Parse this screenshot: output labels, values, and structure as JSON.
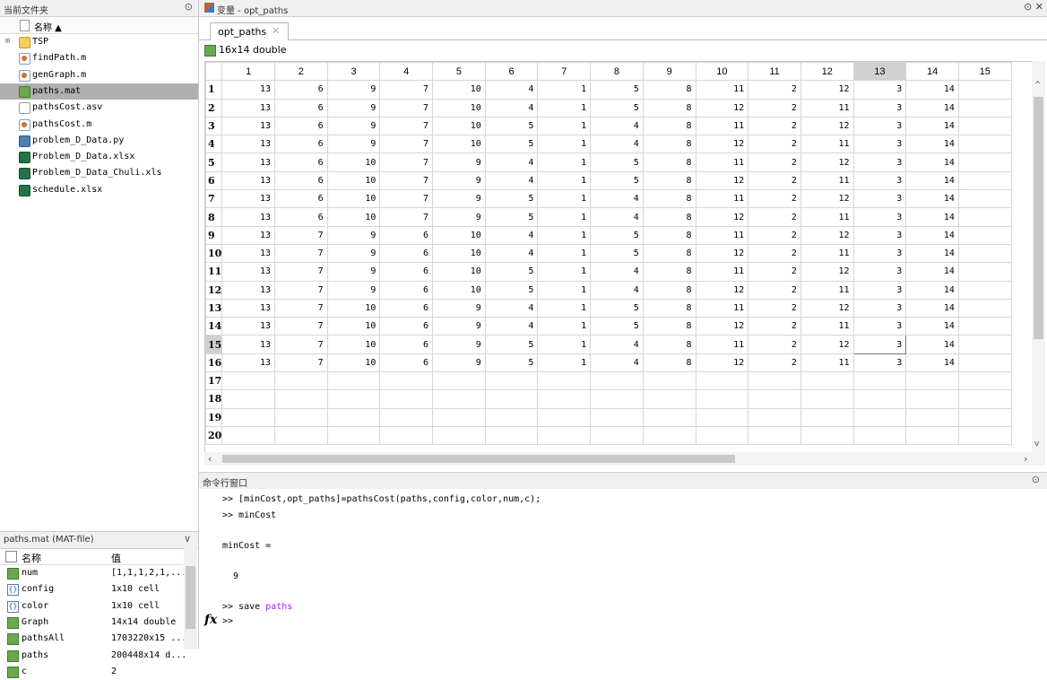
{
  "file_browser": {
    "title": "当前文件夹",
    "column_header": "名称 ▲",
    "items": [
      {
        "name": "TSP",
        "icon": "folder-icon",
        "type": "folder"
      },
      {
        "name": "findPath.m",
        "icon": "m-file-icon",
        "type": "m"
      },
      {
        "name": "genGraph.m",
        "icon": "m-file-icon",
        "type": "m"
      },
      {
        "name": "paths.mat",
        "icon": "mat-file-icon",
        "type": "mat",
        "selected": true
      },
      {
        "name": "pathsCost.asv",
        "icon": "asv-file-icon",
        "type": "asv"
      },
      {
        "name": "pathsCost.m",
        "icon": "m-file-icon",
        "type": "m"
      },
      {
        "name": "problem_D_Data.py",
        "icon": "py-file-icon",
        "type": "py"
      },
      {
        "name": "Problem_D_Data.xlsx",
        "icon": "excel-file-icon",
        "type": "xls"
      },
      {
        "name": "Problem_D_Data_Chuli.xls",
        "icon": "excel-file-icon",
        "type": "xls"
      },
      {
        "name": "schedule.xlsx",
        "icon": "excel-file-icon",
        "type": "xls"
      }
    ]
  },
  "workspace": {
    "title": "paths.mat (MAT-file)",
    "col_name": "名称",
    "col_value": "值",
    "vars": [
      {
        "name": "num",
        "value": "[1,1,1,2,1,...",
        "kind": "double"
      },
      {
        "name": "config",
        "value": "1x10 cell",
        "kind": "cell"
      },
      {
        "name": "color",
        "value": "1x10 cell",
        "kind": "cell"
      },
      {
        "name": "Graph",
        "value": "14x14 double",
        "kind": "double"
      },
      {
        "name": "pathsAll",
        "value": "1703220x15 ...",
        "kind": "double"
      },
      {
        "name": "paths",
        "value": "200448x14 d...",
        "kind": "double"
      },
      {
        "name": "c",
        "value": "2",
        "kind": "double"
      }
    ]
  },
  "variables_editor": {
    "title": "变量 - opt_paths",
    "tab_label": "opt_paths",
    "info": "16x14 double",
    "column_headers": [
      "1",
      "2",
      "3",
      "4",
      "5",
      "6",
      "7",
      "8",
      "9",
      "10",
      "11",
      "12",
      "13",
      "14",
      "15"
    ],
    "row_headers": [
      "1",
      "2",
      "3",
      "4",
      "5",
      "6",
      "7",
      "8",
      "9",
      "10",
      "11",
      "12",
      "13",
      "14",
      "15",
      "16",
      "17",
      "18",
      "19",
      "20"
    ],
    "active_row": 15,
    "active_col": 13,
    "rows": [
      [
        13,
        6,
        9,
        7,
        10,
        4,
        1,
        5,
        8,
        11,
        2,
        12,
        3,
        14
      ],
      [
        13,
        6,
        9,
        7,
        10,
        4,
        1,
        5,
        8,
        12,
        2,
        11,
        3,
        14
      ],
      [
        13,
        6,
        9,
        7,
        10,
        5,
        1,
        4,
        8,
        11,
        2,
        12,
        3,
        14
      ],
      [
        13,
        6,
        9,
        7,
        10,
        5,
        1,
        4,
        8,
        12,
        2,
        11,
        3,
        14
      ],
      [
        13,
        6,
        10,
        7,
        9,
        4,
        1,
        5,
        8,
        11,
        2,
        12,
        3,
        14
      ],
      [
        13,
        6,
        10,
        7,
        9,
        4,
        1,
        5,
        8,
        12,
        2,
        11,
        3,
        14
      ],
      [
        13,
        6,
        10,
        7,
        9,
        5,
        1,
        4,
        8,
        11,
        2,
        12,
        3,
        14
      ],
      [
        13,
        6,
        10,
        7,
        9,
        5,
        1,
        4,
        8,
        12,
        2,
        11,
        3,
        14
      ],
      [
        13,
        7,
        9,
        6,
        10,
        4,
        1,
        5,
        8,
        11,
        2,
        12,
        3,
        14
      ],
      [
        13,
        7,
        9,
        6,
        10,
        4,
        1,
        5,
        8,
        12,
        2,
        11,
        3,
        14
      ],
      [
        13,
        7,
        9,
        6,
        10,
        5,
        1,
        4,
        8,
        11,
        2,
        12,
        3,
        14
      ],
      [
        13,
        7,
        9,
        6,
        10,
        5,
        1,
        4,
        8,
        12,
        2,
        11,
        3,
        14
      ],
      [
        13,
        7,
        10,
        6,
        9,
        4,
        1,
        5,
        8,
        11,
        2,
        12,
        3,
        14
      ],
      [
        13,
        7,
        10,
        6,
        9,
        4,
        1,
        5,
        8,
        12,
        2,
        11,
        3,
        14
      ],
      [
        13,
        7,
        10,
        6,
        9,
        5,
        1,
        4,
        8,
        11,
        2,
        12,
        3,
        14
      ],
      [
        13,
        7,
        10,
        6,
        9,
        5,
        1,
        4,
        8,
        12,
        2,
        11,
        3,
        14
      ]
    ]
  },
  "command_window": {
    "title": "命令行窗口",
    "lines": [
      ">> [minCost,opt_paths]=pathsCost(paths,config,color,num,c);",
      ">> minCost",
      "minCost =",
      "9",
      ">> save paths",
      ">>"
    ],
    "prompt_symbol": "fx"
  },
  "colors": {
    "selected_row": "#b0b0b0",
    "active_header": "#d0d0d0",
    "keyword": "#a020f0"
  }
}
